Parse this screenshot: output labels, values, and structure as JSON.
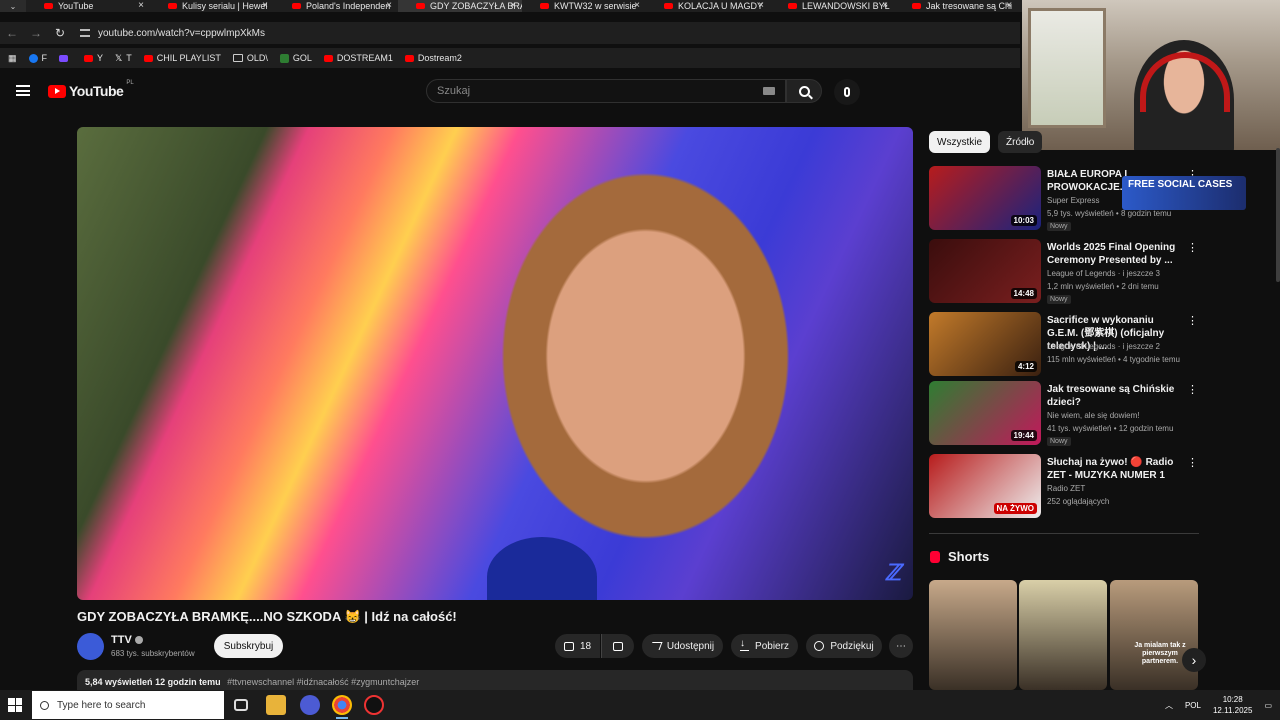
{
  "browser": {
    "tabs": [
      {
        "label": "YouTube",
        "active": false
      },
      {
        "label": "Kulisy serialu | Hewel",
        "active": false
      },
      {
        "label": "Poland's Independen",
        "active": false
      },
      {
        "label": "GDY ZOBACZYŁA BRA",
        "active": true
      },
      {
        "label": "KWTW32 w serwisie",
        "active": false
      },
      {
        "label": "KOLACJA U MAGDY",
        "active": false
      },
      {
        "label": "LEWANDOWSKI BYŁ",
        "active": false
      },
      {
        "label": "Jak tresowane są Chi",
        "active": false
      }
    ],
    "url": "youtube.com/watch?v=cppwlmpXkMs",
    "bookmarks": [
      {
        "label": "F",
        "icon": "facebook-icon"
      },
      {
        "label": "",
        "icon": "twitch-icon"
      },
      {
        "label": "Y",
        "icon": "youtube-icon"
      },
      {
        "label": "T",
        "icon": "x-icon"
      },
      {
        "label": "CHIL PLAYLIST",
        "icon": "youtube-icon"
      },
      {
        "label": "OLD\\",
        "icon": "folder-icon"
      },
      {
        "label": "GOL",
        "icon": "g-icon"
      },
      {
        "label": "DOSTREAM1",
        "icon": "youtube-icon"
      },
      {
        "label": "Dostream2",
        "icon": "youtube-icon"
      }
    ]
  },
  "youtube": {
    "logo_text": "YouTube",
    "country": "PL",
    "search_placeholder": "Szukaj"
  },
  "video": {
    "title": "GDY ZOBACZYŁA BRAMKĘ....NO SZKODA 😸 | Idź na całość!",
    "channel": "TTV",
    "channel_initial": "",
    "subscribers": "683 tys. subskrybentów",
    "subscribe_label": "Subskrybuj",
    "likes": "18",
    "share_label": "Udostępnij",
    "download_label": "Pobierz",
    "thanks_label": "Podziękuj",
    "views": "5,84 wyświetleń",
    "age": "12 godzin temu",
    "tags": "#ttvnewschannel #idźnacałość #zygmuntchajzer"
  },
  "sidebar": {
    "chips": [
      "Wszystkie",
      "Źródło"
    ],
    "recommendations": [
      {
        "title": "BIAŁA EUROPA I PROWOKACJE. MO",
        "channel": "Super Express",
        "meta": "5,9 tys. wyświetleń • 8 godzin temu",
        "badge": "Nowy",
        "duration": "10:03",
        "colors": [
          "#b71c1c",
          "#1a237e"
        ]
      },
      {
        "title": "Worlds 2025 Final Opening Ceremony Presented by ...",
        "channel": "League of Legends · i jeszcze 3",
        "meta": "1,2 mln wyświetleń • 2 dni temu",
        "badge": "Nowy",
        "duration": "14:48",
        "colors": [
          "#3a0d0d",
          "#7a1f1f"
        ]
      },
      {
        "title": "Sacrifice w wykonaniu G.E.M. (鄧紫棋) (oficjalny teledysk) | ...",
        "channel": "League of Legends · i jeszcze 2",
        "meta": "115 mln wyświetleń • 4 tygodnie temu",
        "badge": "",
        "duration": "4:12",
        "colors": [
          "#c27a2a",
          "#3a2010"
        ]
      },
      {
        "title": "Jak tresowane są Chińskie dzieci?",
        "channel": "Nie wiem, ale się dowiem!",
        "meta": "41 tys. wyświetleń • 12 godzin temu",
        "badge": "Nowy",
        "duration": "19:44",
        "colors": [
          "#2e7d32",
          "#c2185b"
        ]
      },
      {
        "title": "Słuchaj na żywo! 🔴 Radio ZET - MUZYKA NUMER 1",
        "channel": "Radio ZET",
        "meta": "252 oglądających",
        "badge": "",
        "duration": "NA ŻYWO",
        "colors": [
          "#b71c1c",
          "#eeeeee"
        ]
      }
    ],
    "free_social_text": "FREE SOCIAL CASES",
    "shorts_title": "Shorts",
    "shorts": [
      {
        "caption": "",
        "color": "#c7a98a"
      },
      {
        "caption": "",
        "color": "#d9cfa8"
      },
      {
        "caption": "Ja mialam tak z pierwszym partnerem.",
        "color": "#b89b7c"
      }
    ]
  },
  "taskbar": {
    "search_placeholder": "Type here to search",
    "language": "POL",
    "time": "10:28",
    "date": "12.11.2025"
  }
}
